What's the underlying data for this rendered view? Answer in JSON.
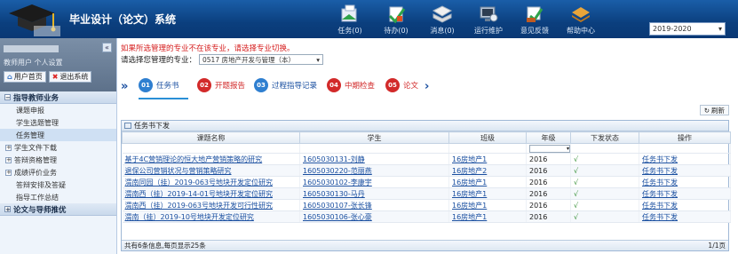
{
  "app": {
    "title": "毕业设计（论文）系统"
  },
  "nav": [
    {
      "label": "任务(0)",
      "icon": "tasks-icon"
    },
    {
      "label": "待办(0)",
      "icon": "todo-icon"
    },
    {
      "label": "消息(0)",
      "icon": "message-icon"
    },
    {
      "label": "运行维护",
      "icon": "maintenance-icon"
    },
    {
      "label": "意见反馈",
      "icon": "feedback-icon"
    },
    {
      "label": "帮助中心",
      "icon": "help-icon"
    }
  ],
  "year_select": {
    "value": "2019-2020"
  },
  "sidebar": {
    "user_info": "教师用户  个人设置",
    "home_btn": "用户首页",
    "logout_btn": "退出系统",
    "sections": [
      {
        "title": "指导教师业务"
      },
      {
        "title": "论文与导师推优"
      }
    ],
    "items": [
      {
        "label": "课题申报",
        "active": false,
        "expandable": false
      },
      {
        "label": "学生选题管理",
        "active": false,
        "expandable": false
      },
      {
        "label": "任务管理",
        "active": true,
        "expandable": false
      },
      {
        "label": "学生文件下载",
        "active": false,
        "expandable": true
      },
      {
        "label": "答辩资格管理",
        "active": false,
        "expandable": true
      },
      {
        "label": "成绩评价业务",
        "active": false,
        "expandable": true
      },
      {
        "label": "答辩安排及答疑",
        "active": false,
        "expandable": false
      },
      {
        "label": "指导工作总结",
        "active": false,
        "expandable": false
      }
    ]
  },
  "main": {
    "notice": "如果所选管理的专业不在该专业，请选择专业切换。",
    "major_label": "请选择您管理的专业：",
    "major_value": "0517 房地产开发与管理（本）",
    "steps": [
      {
        "num": "01",
        "label": "任务书",
        "color": "#2f7fd0"
      },
      {
        "num": "02",
        "label": "开题报告",
        "color": "#d22a2a"
      },
      {
        "num": "03",
        "label": "过程指导记录",
        "color": "#2f7fd0"
      },
      {
        "num": "04",
        "label": "中期检查",
        "color": "#d22a2a"
      },
      {
        "num": "05",
        "label": "论文",
        "color": "#d22a2a"
      }
    ],
    "refresh": "刷新",
    "grid": {
      "title": "任务书下发",
      "columns": [
        "课题名称",
        "学生",
        "班级",
        "年级",
        "下发状态",
        "操作"
      ],
      "rows": [
        {
          "title": "基于4C营销理论的恒大地产营销策略的研究",
          "student": "1605030131-刘静",
          "class": "16房地产1",
          "grade": "2016",
          "status": "√",
          "action": "任务书下发"
        },
        {
          "title": "退保公司营销状况与营销策略研究",
          "student": "1605030220-范丽燕",
          "class": "16房地产2",
          "grade": "2016",
          "status": "√",
          "action": "任务书下发"
        },
        {
          "title": "渭南同园（挂）2019-063号地块开发定位研究",
          "student": "1605030102-李康宇",
          "class": "16房地产1",
          "grade": "2016",
          "status": "√",
          "action": "任务书下发"
        },
        {
          "title": "渭南西（挂）2019-14-01号地块开发定位研究",
          "student": "1605030130-马丹",
          "class": "16房地产1",
          "grade": "2016",
          "status": "√",
          "action": "任务书下发"
        },
        {
          "title": "渭南西（挂）2019-063号地块开发可行性研究",
          "student": "1605030107-张长锋",
          "class": "16房地产1",
          "grade": "2016",
          "status": "√",
          "action": "任务书下发"
        },
        {
          "title": "渭南（挂）2019-10号地块开发定位研究",
          "student": "1605030106-张心豪",
          "class": "16房地产1",
          "grade": "2016",
          "status": "√",
          "action": "任务书下发"
        }
      ],
      "footer_left": "共有6条信息,每页显示25条",
      "footer_right": "1/1页"
    }
  },
  "colors": {
    "header": "#0b3f7e",
    "accent": "#1a4fa0",
    "alert": "#d62020"
  }
}
